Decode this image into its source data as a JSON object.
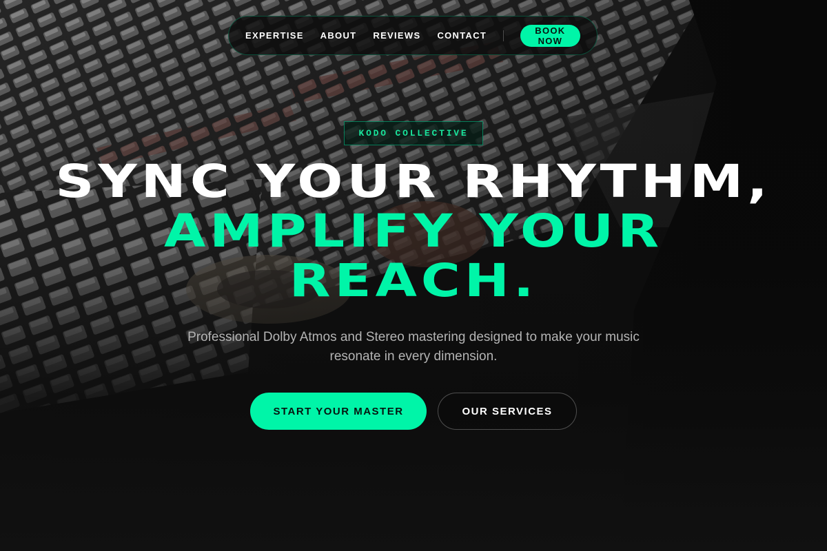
{
  "nav": {
    "links": [
      "EXPERTISE",
      "ABOUT",
      "REVIEWS",
      "CONTACT"
    ],
    "cta_label": "BOOK NOW"
  },
  "hero": {
    "badge": "KODO COLLECTIVE",
    "headline_line1": "SYNC YOUR RHYTHM,",
    "headline_line2": "AMPLIFY YOUR",
    "headline_line3": "REACH.",
    "subtitle": "Professional Dolby Atmos and Stereo mastering designed to make your music resonate in every dimension.",
    "primary_cta": "START YOUR MASTER",
    "secondary_cta": "OUR SERVICES"
  },
  "colors": {
    "accent": "#00f5a8",
    "background": "#111111",
    "text": "#ffffff",
    "muted_text": "#b4b4b4"
  }
}
